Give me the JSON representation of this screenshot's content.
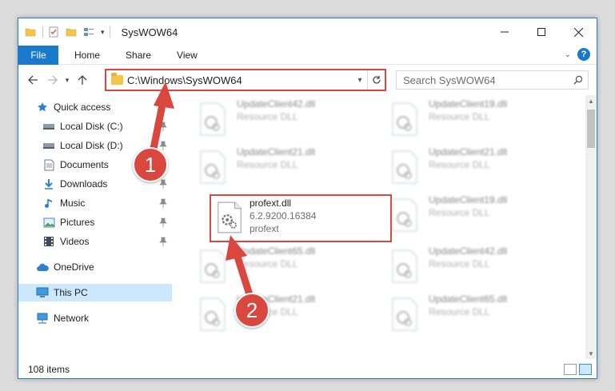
{
  "window": {
    "title": "SysWOW64"
  },
  "ribbon": {
    "tabs": [
      "File",
      "Home",
      "Share",
      "View"
    ],
    "help": "?"
  },
  "nav": {
    "address": "C:\\Windows\\SysWOW64",
    "search_placeholder": "Search SysWOW64"
  },
  "sidebar": {
    "items": [
      {
        "label": "Quick access",
        "icon": "star-icon",
        "pinned": false
      },
      {
        "label": "Local Disk (C:)",
        "icon": "drive-icon",
        "pinned": true
      },
      {
        "label": "Local Disk (D:)",
        "icon": "drive-icon",
        "pinned": true
      },
      {
        "label": "Documents",
        "icon": "documents-icon",
        "pinned": true
      },
      {
        "label": "Downloads",
        "icon": "downloads-icon",
        "pinned": true
      },
      {
        "label": "Music",
        "icon": "music-icon",
        "pinned": true
      },
      {
        "label": "Pictures",
        "icon": "pictures-icon",
        "pinned": true
      },
      {
        "label": "Videos",
        "icon": "videos-icon",
        "pinned": true
      },
      {
        "label": "OneDrive",
        "icon": "onedrive-icon",
        "pinned": false
      },
      {
        "label": "This PC",
        "icon": "pc-icon",
        "pinned": false,
        "selected": true
      },
      {
        "label": "Network",
        "icon": "network-icon",
        "pinned": false
      }
    ]
  },
  "files": [
    {
      "name": "UpdateClient42.dll",
      "sub1": "Resource DLL",
      "sub2": ""
    },
    {
      "name": "UpdateClient19.dll",
      "sub1": "Resource DLL",
      "sub2": ""
    },
    {
      "name": "UpdateClient21.dll",
      "sub1": "Resource DLL",
      "sub2": ""
    },
    {
      "name": "UpdateClient21.dll",
      "sub1": "Resource DLL",
      "sub2": ""
    },
    {
      "name": "profext.dll",
      "sub1": "6.2.9200.16384",
      "sub2": "profext"
    },
    {
      "name": "UpdateClient19.dll",
      "sub1": "Resource DLL",
      "sub2": ""
    },
    {
      "name": "UpdateClient65.dll",
      "sub1": "Resource DLL",
      "sub2": ""
    },
    {
      "name": "UpdateClient42.dll",
      "sub1": "Resource DLL",
      "sub2": ""
    },
    {
      "name": "UpdateClient21.dll",
      "sub1": "Resource DLL",
      "sub2": ""
    },
    {
      "name": "UpdateClient65.dll",
      "sub1": "Resource DLL",
      "sub2": ""
    }
  ],
  "status": {
    "items": "108 items"
  },
  "annotations": {
    "step1": "1",
    "step2": "2",
    "color": "#d9473f"
  }
}
